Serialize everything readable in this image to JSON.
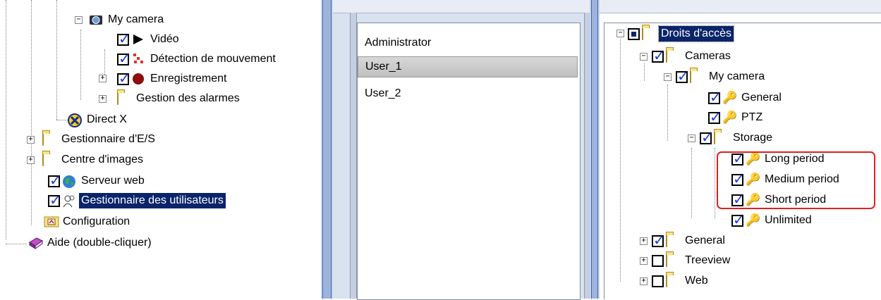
{
  "left_tree": {
    "my_camera": "My camera",
    "video": "Vidéo",
    "motion_detection": "Détection de mouvement",
    "recording": "Enregistrement",
    "alarm_management": "Gestion des alarmes",
    "direct_x": "Direct X",
    "io_manager": "Gestionnaire d'E/S",
    "image_center": "Centre d'images",
    "web_server": "Serveur web",
    "user_manager": "Gestionnaire des utilisateurs",
    "configuration": "Configuration",
    "help": "Aide (double-cliquer)"
  },
  "users": {
    "items": [
      "Administrator",
      "User_1",
      "User_2"
    ],
    "selected": "User_1"
  },
  "rights_tree": {
    "root": "Droits d'accès",
    "cameras": "Cameras",
    "my_camera": "My camera",
    "general": "General",
    "ptz": "PTZ",
    "storage": "Storage",
    "long_period": "Long period",
    "medium_period": "Medium period",
    "short_period": "Short period",
    "unlimited": "Unlimited",
    "general_root": "General",
    "treeview": "Treeview",
    "web": "Web"
  },
  "colors": {
    "selection": "#0a246a",
    "check": "#1d3bd6",
    "highlight": "#e02020",
    "splitter": "#9fb4dc"
  }
}
